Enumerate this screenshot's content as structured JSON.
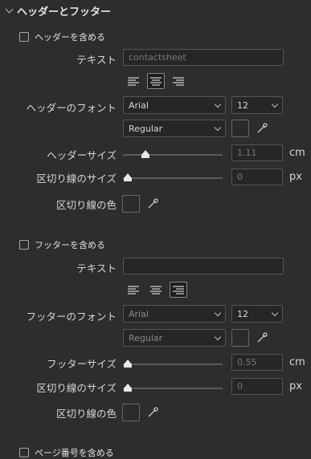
{
  "section": {
    "title": "ヘッダーとフッター"
  },
  "header": {
    "include_label": "ヘッダーを含める",
    "text_label": "テキスト",
    "text_value": "contactsheet",
    "font_label": "ヘッダーのフォント",
    "font_family": "Arial",
    "font_size": "12",
    "font_style": "Regular",
    "size_label": "ヘッダーサイズ",
    "size_value": "1.11",
    "size_unit": "cm",
    "size_fraction": 0.2,
    "divider_size_label": "区切り線のサイズ",
    "divider_size_value": "0",
    "divider_unit": "px",
    "divider_fraction": 0.0,
    "divider_color_label": "区切り線の色",
    "alignment": "center"
  },
  "footer": {
    "include_label": "フッターを含める",
    "text_label": "テキスト",
    "text_value": "",
    "font_label": "フッターのフォント",
    "font_family": "Arial",
    "font_size": "12",
    "font_style": "Regular",
    "size_label": "フッターサイズ",
    "size_value": "0.55",
    "size_unit": "cm",
    "size_fraction": 0.0,
    "divider_size_label": "区切り線のサイズ",
    "divider_size_value": "0",
    "divider_unit": "px",
    "divider_fraction": 0.0,
    "divider_color_label": "区切り線の色",
    "alignment": "right"
  },
  "page_number": {
    "include_label": "ページ番号を含める"
  }
}
